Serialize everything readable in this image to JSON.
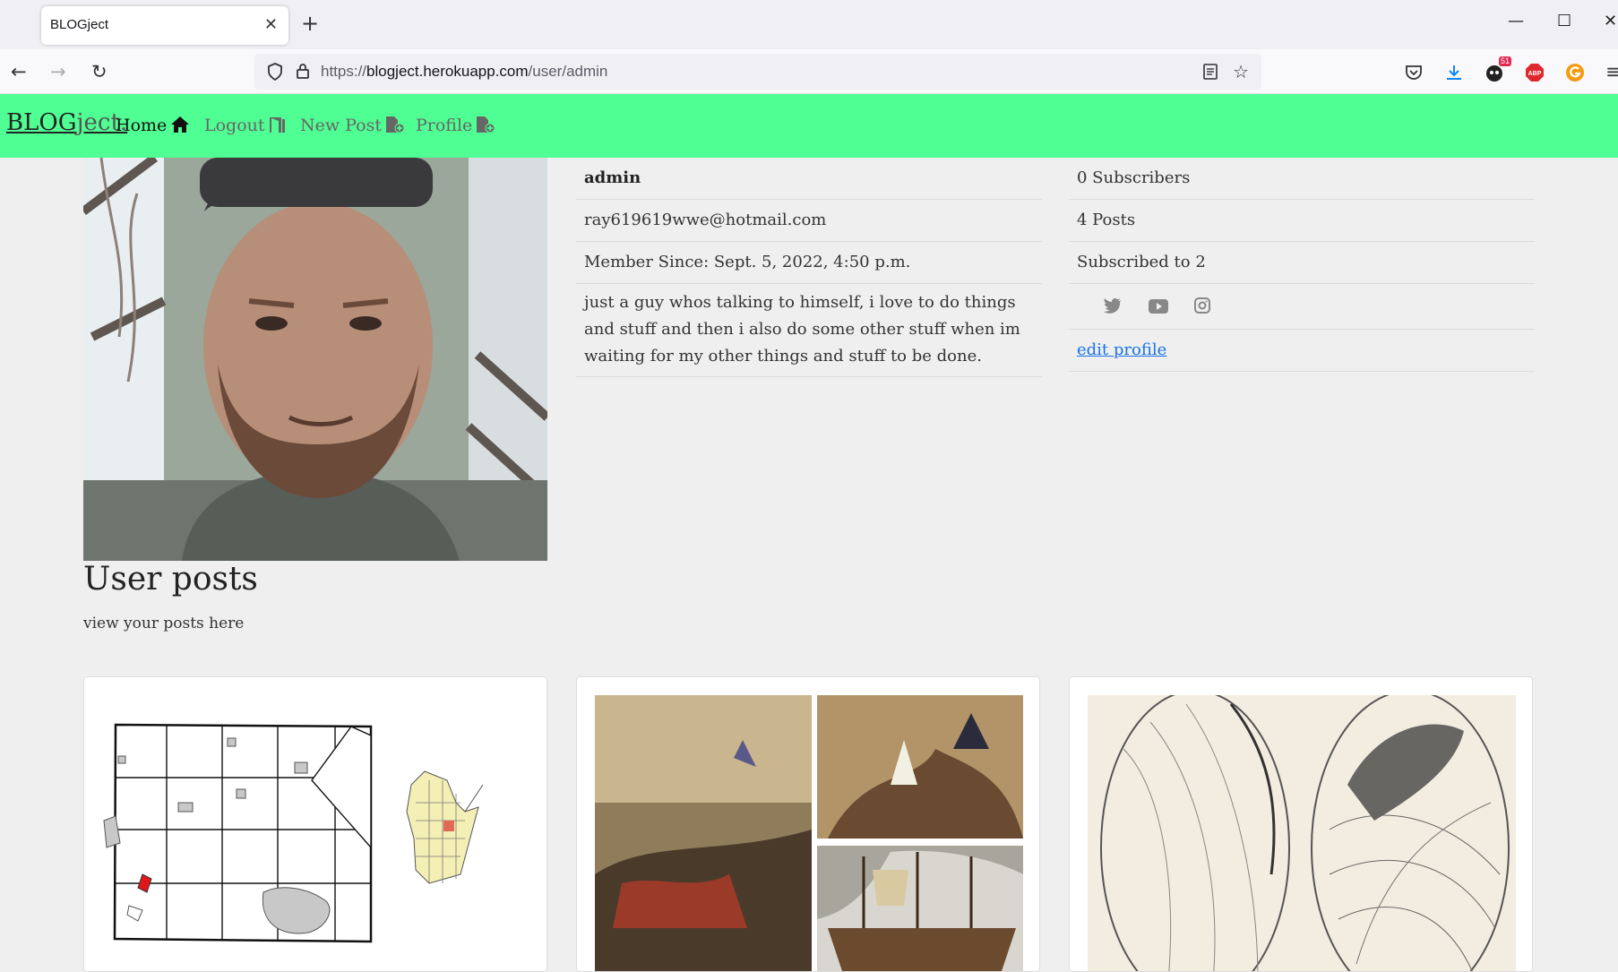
{
  "browser": {
    "tab_title": "BLOGject",
    "url_protocol": "https://",
    "url_host": "blogject.herokuapp.com",
    "url_path": "/user/admin",
    "badge_count": "51"
  },
  "site": {
    "brand_main": "BLOG",
    "brand_suffix": "ject.",
    "nav": [
      {
        "label": "Home"
      },
      {
        "label": "Logout"
      },
      {
        "label": "New Post"
      },
      {
        "label": "Profile"
      }
    ]
  },
  "profile": {
    "username": "admin",
    "email": "ray619619wwe@hotmail.com",
    "member_since": "Member Since: Sept. 5, 2022, 4:50 p.m.",
    "bio": "just a guy whos talking to himself, i love to do things and stuff and then i also do some other stuff when im waiting for my other things and stuff to be done.",
    "subscribers": "0 Subscribers",
    "posts": "4 Posts",
    "subscribed_to": "Subscribed to 2",
    "edit_link": "edit profile",
    "social_icons": [
      "twitter-icon",
      "youtube-icon",
      "instagram-icon"
    ]
  },
  "posts_section": {
    "title": "User posts",
    "subtitle": "view your posts here"
  },
  "colors": {
    "nav_green": "#50ff93",
    "link_blue": "#1a73e8"
  }
}
